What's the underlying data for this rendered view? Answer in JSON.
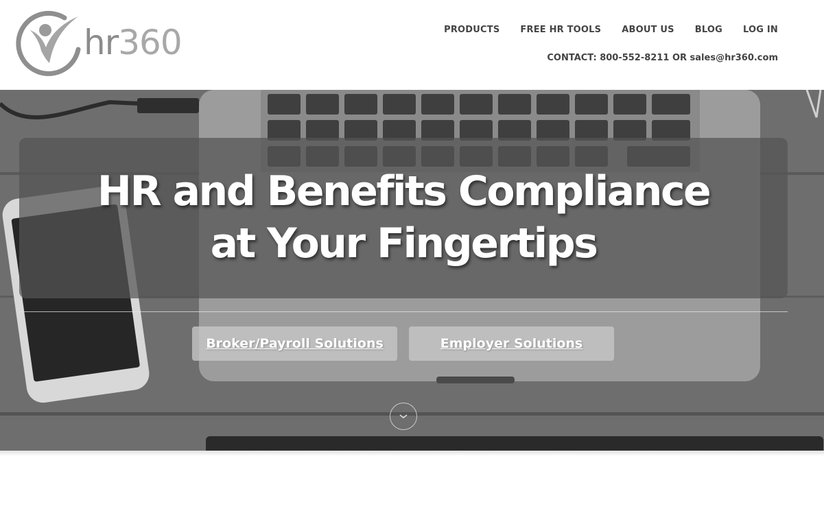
{
  "brand": {
    "logo_text_hr": "hr",
    "logo_text_num": "360",
    "logo_icon": "person-swoosh-icon"
  },
  "nav": {
    "items": [
      {
        "label": "PRODUCTS"
      },
      {
        "label": "FREE HR TOOLS"
      },
      {
        "label": "ABOUT US"
      },
      {
        "label": "BLOG"
      },
      {
        "label": "LOG IN"
      }
    ]
  },
  "contact": {
    "label": "CONTACT: 800-552-8211 OR sales@hr360.com"
  },
  "hero": {
    "headline_line1": "HR and Benefits Compliance",
    "headline_line2": "at Your Fingertips",
    "buttons": [
      {
        "label": "Broker/Payroll Solutions"
      },
      {
        "label": "Employer Solutions"
      }
    ],
    "scroll_icon": "chevron-down-icon"
  },
  "colors": {
    "nav_text": "#444444",
    "logo_gray": "#9a9a9a",
    "hero_overlay": "#555555",
    "button_bg": "#c8c8c8"
  }
}
